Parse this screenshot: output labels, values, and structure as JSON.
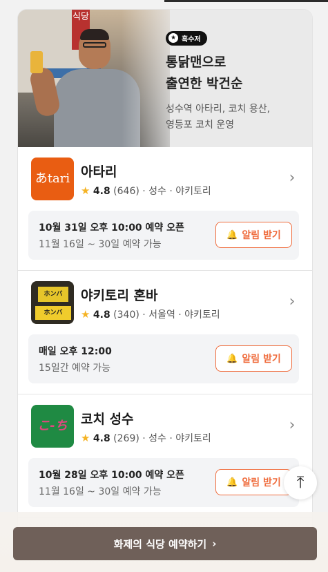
{
  "hero": {
    "badge_icon": "tv-icon",
    "badge_label": "흑수저",
    "title_line1": "통닭맨으로",
    "title_line2": "출연한 박건순",
    "subtitle_line1": "성수역 아타리, 코치 용산,",
    "subtitle_line2": "영등포 코치 운영",
    "photo_sign": "식당"
  },
  "restaurants": [
    {
      "name": "아타리",
      "logo_text": "あtari",
      "rating": "4.8",
      "reviews": "(646)",
      "location_category": "· 성수 · 야키토리",
      "line1": "10월 31일 오후 10:00 예약 오픈",
      "line2": "11월 16일 ~ 30일 예약 가능",
      "button": "알림 받기"
    },
    {
      "name": "야키토리 혼바",
      "logo_text": "ホンバ",
      "rating": "4.8",
      "reviews": "(340)",
      "location_category": "· 서울역 · 야키토리",
      "line1": "매일 오후 12:00",
      "line2": "15일간 예약 가능",
      "button": "알림 받기"
    },
    {
      "name": "코치 성수",
      "logo_text": "こ-ち",
      "rating": "4.8",
      "reviews": "(269)",
      "location_category": "· 성수 · 야키토리",
      "line1": "10월 28일 오후 10:00 예약 오픈",
      "line2": "11월 16일 ~ 30일 예약 가능",
      "button": "알림 받기"
    }
  ],
  "cta": {
    "label": "화제의 식당 예약하기",
    "icon": "chevron-right-icon"
  },
  "colors": {
    "accent": "#ef6b3b",
    "cta_bg": "#6f6059",
    "star": "#f5b324"
  }
}
